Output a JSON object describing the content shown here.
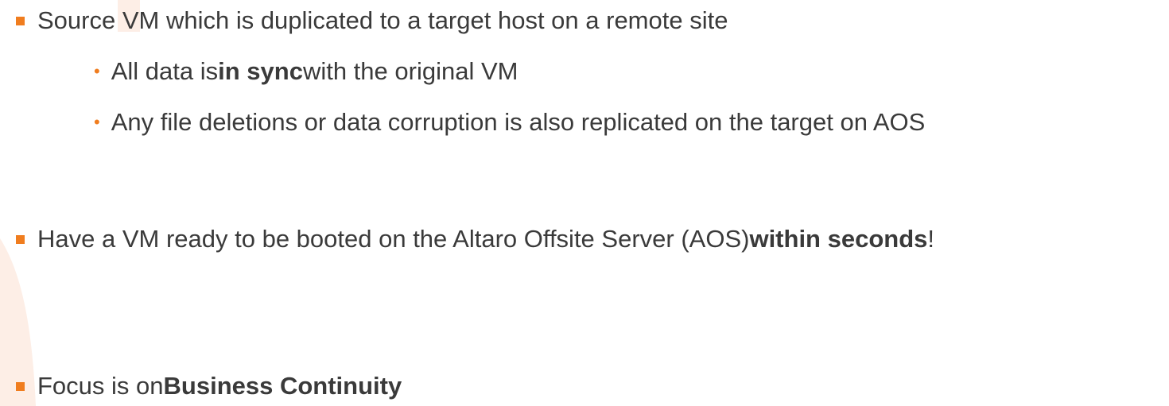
{
  "slide": {
    "accent_color": "#f07d1f",
    "watermark_color": "#fdeee6",
    "bullets": [
      {
        "pre": "Source VM which is duplicated to a target host on a remote site",
        "bold": "",
        "post": "",
        "sub": [
          {
            "pre": "All data is ",
            "bold": "in sync",
            "post": " with the original VM"
          },
          {
            "pre": "Any file deletions or data corruption is also replicated on the target on AOS",
            "bold": "",
            "post": ""
          }
        ]
      },
      {
        "pre": "Have a VM ready to be booted on the Altaro Offsite Server (AOS) ",
        "bold": "within seconds",
        "post": "!"
      },
      {
        "pre": "Focus is on ",
        "bold": "Business Continuity",
        "post": ""
      }
    ]
  }
}
